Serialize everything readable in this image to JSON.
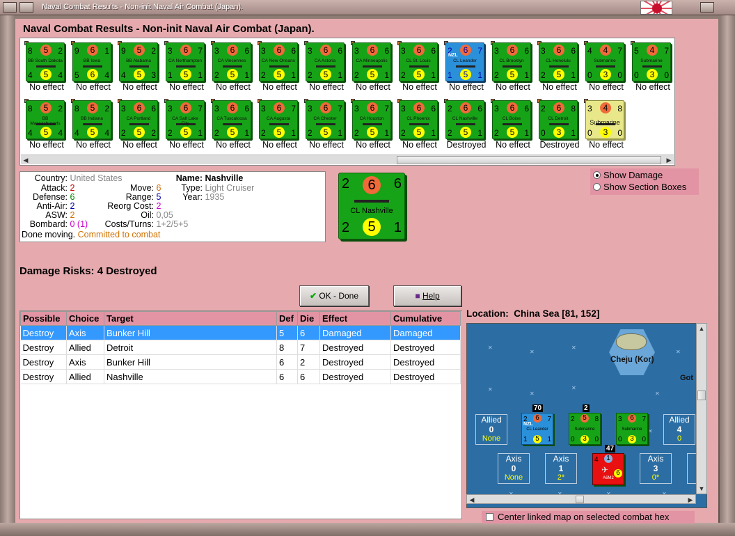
{
  "window": {
    "title": "Naval Combat Results - Non-init Naval Air Combat (Japan)."
  },
  "heading": "Naval Combat Results - Non-init Naval Air Combat (Japan).",
  "units_row1": [
    {
      "name": "BB South Dakota",
      "tl": "8",
      "att": "5",
      "tr": "2",
      "bl": "4",
      "mov": "5",
      "br": "4",
      "color": "green",
      "result": "No effect"
    },
    {
      "name": "BB Iowa",
      "tl": "9",
      "att": "6",
      "tr": "1",
      "bl": "5",
      "mov": "6",
      "br": "4",
      "color": "green",
      "result": "No effect"
    },
    {
      "name": "BB Alabama",
      "tl": "9",
      "att": "5",
      "tr": "2",
      "bl": "4",
      "mov": "5",
      "br": "3",
      "color": "green",
      "result": "No effect"
    },
    {
      "name": "CA Northampton",
      "tl": "3",
      "att": "6",
      "tr": "7",
      "bl": "1",
      "mov": "5",
      "br": "1",
      "color": "green",
      "result": "No effect"
    },
    {
      "name": "CA Vincennes",
      "tl": "3",
      "att": "6",
      "tr": "6",
      "bl": "2",
      "mov": "5",
      "br": "1",
      "color": "green",
      "result": "No effect"
    },
    {
      "name": "CA New Orleans",
      "tl": "3",
      "att": "6",
      "tr": "6",
      "bl": "2",
      "mov": "5",
      "br": "1",
      "color": "green",
      "result": "No effect"
    },
    {
      "name": "CA Astoria",
      "tl": "3",
      "att": "6",
      "tr": "6",
      "bl": "2",
      "mov": "5",
      "br": "1",
      "color": "green",
      "result": "No effect"
    },
    {
      "name": "CA Minneapolis",
      "tl": "3",
      "att": "6",
      "tr": "6",
      "bl": "2",
      "mov": "5",
      "br": "1",
      "color": "green",
      "result": "No effect"
    },
    {
      "name": "CL St. Louis",
      "tl": "3",
      "att": "6",
      "tr": "6",
      "bl": "2",
      "mov": "5",
      "br": "1",
      "color": "green",
      "result": "No effect"
    },
    {
      "name": "CL Leander",
      "tl": "2",
      "att": "6",
      "tr": "7",
      "bl": "1",
      "mov": "5",
      "br": "1",
      "color": "blue",
      "flag": "NZL",
      "result": "No effect"
    },
    {
      "name": "CL Brooklyn",
      "tl": "3",
      "att": "6",
      "tr": "6",
      "bl": "2",
      "mov": "5",
      "br": "1",
      "color": "green",
      "result": "No effect"
    },
    {
      "name": "CL Honolulu",
      "tl": "3",
      "att": "6",
      "tr": "6",
      "bl": "2",
      "mov": "5",
      "br": "1",
      "color": "green",
      "result": "No effect"
    },
    {
      "name": "Submarine",
      "tl": "4",
      "att": "4",
      "tr": "7",
      "bl": "0",
      "mov": "3",
      "br": "0",
      "color": "green",
      "result": "No effect"
    },
    {
      "name": "Submarine",
      "tl": "5",
      "att": "4",
      "tr": "7",
      "bl": "0",
      "mov": "3",
      "br": "0",
      "color": "green",
      "result": "No effect"
    }
  ],
  "units_row2": [
    {
      "name": "BB Massachusetts",
      "tl": "8",
      "att": "5",
      "tr": "2",
      "bl": "4",
      "mov": "5",
      "br": "4",
      "color": "green",
      "result": "No effect"
    },
    {
      "name": "BB Indiana",
      "tl": "8",
      "att": "5",
      "tr": "2",
      "bl": "4",
      "mov": "5",
      "br": "4",
      "color": "green",
      "result": "No effect"
    },
    {
      "name": "CA Portland",
      "tl": "3",
      "att": "6",
      "tr": "6",
      "bl": "2",
      "mov": "5",
      "br": "2",
      "color": "green",
      "result": "No effect"
    },
    {
      "name": "CA Salt Lake City",
      "tl": "3",
      "att": "6",
      "tr": "7",
      "bl": "2",
      "mov": "5",
      "br": "1",
      "color": "green",
      "result": "No effect"
    },
    {
      "name": "CA Tuscaloosa",
      "tl": "3",
      "att": "6",
      "tr": "6",
      "bl": "2",
      "mov": "5",
      "br": "1",
      "color": "green",
      "result": "No effect"
    },
    {
      "name": "CA Augusta",
      "tl": "3",
      "att": "6",
      "tr": "7",
      "bl": "2",
      "mov": "5",
      "br": "1",
      "color": "green",
      "result": "No effect"
    },
    {
      "name": "CA Chester",
      "tl": "3",
      "att": "6",
      "tr": "7",
      "bl": "2",
      "mov": "5",
      "br": "1",
      "color": "green",
      "result": "No effect"
    },
    {
      "name": "CA Houston",
      "tl": "3",
      "att": "6",
      "tr": "7",
      "bl": "2",
      "mov": "5",
      "br": "1",
      "color": "green",
      "result": "No effect"
    },
    {
      "name": "CL Phoenix",
      "tl": "3",
      "att": "6",
      "tr": "6",
      "bl": "2",
      "mov": "5",
      "br": "1",
      "color": "green",
      "result": "No effect"
    },
    {
      "name": "CL Nashville",
      "tl": "2",
      "att": "6",
      "tr": "6",
      "bl": "2",
      "mov": "5",
      "br": "1",
      "color": "green",
      "result": "Destroyed"
    },
    {
      "name": "CL Boise",
      "tl": "3",
      "att": "6",
      "tr": "6",
      "bl": "2",
      "mov": "5",
      "br": "1",
      "color": "green",
      "result": "No effect"
    },
    {
      "name": "CL Detroit",
      "tl": "2",
      "att": "6",
      "tr": "8",
      "bl": "0",
      "mov": "3",
      "br": "1",
      "color": "green",
      "result": "Destroyed"
    },
    {
      "name": "Submarine",
      "tl": "3",
      "att": "4",
      "tr": "8",
      "bl": "0",
      "mov": "3",
      "br": "0",
      "color": "yellow",
      "result": "No effect"
    }
  ],
  "info": {
    "country_label": "Country:",
    "country": "United States",
    "attack_label": "Attack:",
    "attack": "2",
    "defense_label": "Defense:",
    "defense": "6",
    "antiair_label": "Anti-Air:",
    "antiair": "2",
    "asw_label": "ASW:",
    "asw": "2",
    "bombard_label": "Bombard:",
    "bombard": "0 (1)",
    "move_label": "Move:",
    "move": "6",
    "range_label": "Range:",
    "range": "5",
    "reorg_label": "Reorg Cost:",
    "reorg": "2",
    "oil_label": "Oil:",
    "oil": "0,05",
    "costs_label": "Costs/Turns:",
    "costs": "1+2/5+5",
    "name_label": "Name:",
    "name": "Nashville",
    "type_label": "Type:",
    "type": "Light Cruiser",
    "year_label": "Year:",
    "year": "1935",
    "status_label": "Done moving.",
    "status": "Committed to combat"
  },
  "big_counter": {
    "tl": "2",
    "att": "6",
    "tr": "6",
    "bl": "2",
    "mov": "5",
    "br": "1",
    "name": "CL Nashville"
  },
  "radio": {
    "opt1": "Show Damage",
    "opt2": "Show Section Boxes",
    "selected": "opt1"
  },
  "damage_risks": "Damage Risks: 4 Destroyed",
  "buttons": {
    "ok": "OK - Done",
    "help": "Help"
  },
  "table": {
    "headers": [
      "Possible",
      "Choice",
      "Target",
      "Def",
      "Die",
      "Effect",
      "Cumulative"
    ],
    "rows": [
      [
        "Destroy",
        "Axis",
        "Bunker Hill",
        "5",
        "6",
        "Damaged",
        "Damaged"
      ],
      [
        "Destroy",
        "Allied",
        "Detroit",
        "8",
        "7",
        "Destroyed",
        "Destroyed"
      ],
      [
        "Destroy",
        "Axis",
        "Bunker Hill",
        "6",
        "2",
        "Destroyed",
        "Destroyed"
      ],
      [
        "Destroy",
        "Allied",
        "Nashville",
        "6",
        "6",
        "Destroyed",
        "Destroyed"
      ]
    ]
  },
  "location": {
    "label": "Location:",
    "value": "China Sea [81, 152]"
  },
  "map": {
    "hex_label": "Cheju (Kor)",
    "edge_label": "Got",
    "allied_left": {
      "title": "Allied",
      "value": "0",
      "sub": "None"
    },
    "allied_right": {
      "title": "Allied",
      "value": "4",
      "sub": "0"
    },
    "axis1": {
      "title": "Axis",
      "value": "0",
      "sub": "None"
    },
    "axis2": {
      "title": "Axis",
      "value": "1",
      "sub": "2*"
    },
    "axis3": {
      "title": "Axis",
      "value": "3",
      "sub": "0*"
    },
    "stack_leander": "70",
    "stack_sub": "2",
    "stack_axis": "47",
    "leander": {
      "tl": "2",
      "att": "6",
      "tr": "7",
      "bl": "1",
      "mov": "5",
      "br": "1",
      "name": "CL Leander",
      "flag": "NZL"
    },
    "sub1": {
      "tl": "2",
      "att": "5",
      "tr": "8",
      "bl": "0",
      "mov": "3",
      "br": "0",
      "name": "Submarine"
    },
    "sub2": {
      "tl": "3",
      "att": "6",
      "tr": "7",
      "bl": "0",
      "mov": "3",
      "br": "0",
      "name": "Submarine"
    },
    "axis_unit": {
      "tl": "4",
      "att": "1",
      "mov": "6",
      "name": "A6M2"
    }
  },
  "center_checkbox": "Center linked map on selected combat hex",
  "colors": {
    "panel": "#e6aaae",
    "header": "#e294a4",
    "counter_green": "#17a317",
    "counter_blue": "#2a90da",
    "selected_row": "#3399ff"
  }
}
